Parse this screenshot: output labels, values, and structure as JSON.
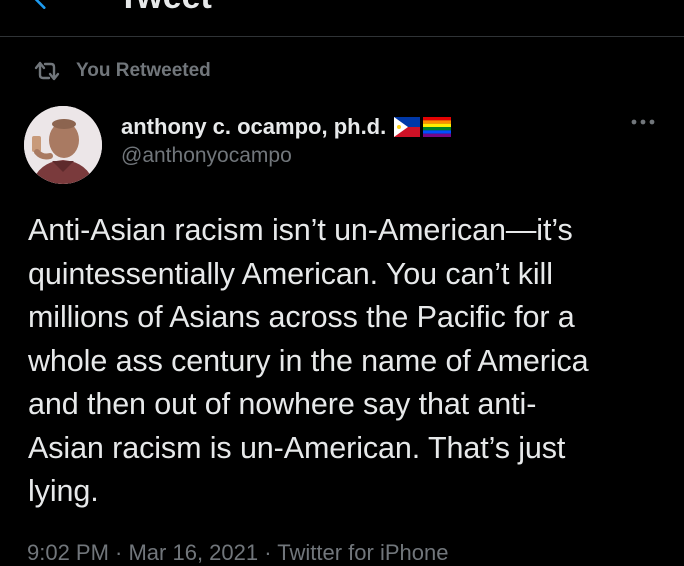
{
  "header": {
    "title": "Tweet",
    "back_icon": "chevron-left-icon"
  },
  "retweet": {
    "label": "You Retweeted",
    "icon": "retweet-icon"
  },
  "author": {
    "display_name": "anthony c. ocampo, ph.d.",
    "handle": "@anthonyocampo",
    "badges": [
      "philippines-flag-icon",
      "rainbow-flag-icon"
    ]
  },
  "tweet": {
    "text": "Anti-Asian racism isn’t un-American—it’s\nquintessentially American. You can’t kill\nmillions of Asians across the Pacific for a\nwhole ass century in the name of America\nand then out of nowhere say that anti-\nAsian racism is un-American. That’s just\nlying.",
    "time": "9:02 PM",
    "date": "Mar 16, 2021",
    "source": "Twitter for iPhone",
    "meta": "9:02 PM · Mar 16, 2021 · Twitter for iPhone"
  },
  "colors": {
    "background": "#000000",
    "text": "#e7e9ea",
    "secondary": "#71767b",
    "accent": "#1d9bf0"
  }
}
